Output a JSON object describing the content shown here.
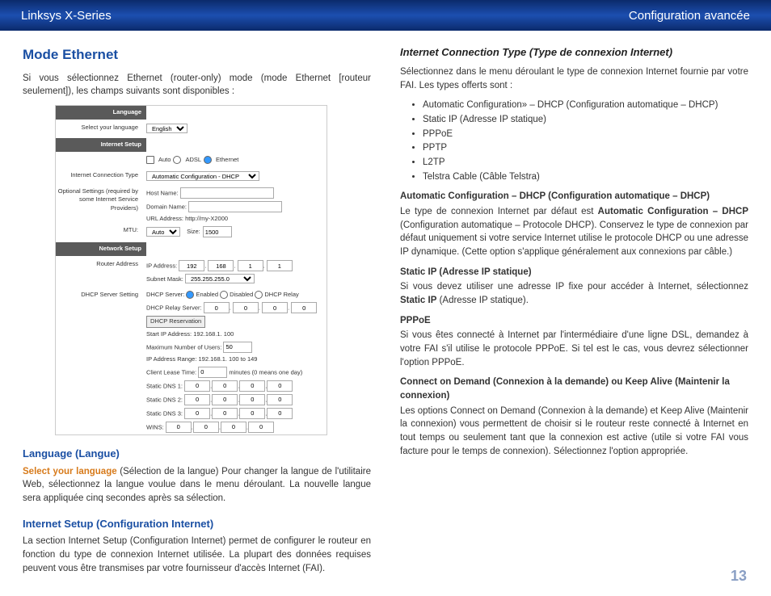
{
  "header": {
    "left": "Linksys X-Series",
    "right": "Configuration avancée"
  },
  "pageNumber": "13",
  "left": {
    "h2": "Mode Ethernet",
    "intro": "Si vous sélectionnez Ethernet (router-only) mode (mode Ethernet [routeur seulement]), les champs suivants sont disponibles :",
    "langH": "Language (Langue)",
    "langLead": "Select your language",
    "langBody": " (Sélection de la langue)  Pour changer la langue de l'utilitaire Web, sélectionnez la langue voulue dans le menu déroulant. La nouvelle langue sera appliquée cinq secondes après sa sélection.",
    "isH": "Internet Setup (Configuration Internet)",
    "isBody": "La section Internet Setup (Configuration Internet) permet de configurer le routeur en fonction du type de connexion Internet utilisée. La plupart des données requises peuvent vous être transmises par votre fournisseur d'accès Internet (FAI).",
    "italicInternetSetup": "Internet Setup"
  },
  "shot": {
    "language": "Language",
    "selectLang": "Select your language",
    "english": "English",
    "internetSetup": "Internet Setup",
    "auto": "Auto",
    "adsl": "ADSL",
    "ethernet": "Ethernet",
    "ict": "Internet Connection Type",
    "ictVal": "Automatic Configuration - DHCP",
    "optional": "Optional Settings (required by some Internet Service Providers)",
    "hostName": "Host Name:",
    "domainName": "Domain Name:",
    "urlAddress": "URL Address:",
    "urlVal": "http://my-X2000",
    "mtu": "MTU:",
    "mtuAuto": "Auto",
    "size": "Size:",
    "sizeVal": "1500",
    "networkSetup": "Network Setup",
    "routerAddress": "Router Address",
    "ipAddress": "IP Address:",
    "subnet": "Subnet Mask:",
    "subnetVal": "255.255.255.0",
    "dhcpSetting": "DHCP Server Setting",
    "dhcpServer": "DHCP Server:",
    "enabled": "Enabled",
    "disabled": "Disabled",
    "relay": "DHCP Relay",
    "relayServer": "DHCP Relay Server:",
    "reservation": "DHCP Reservation",
    "startIP": "Start IP Address:",
    "startIPVal": "192.168.1. 100",
    "maxUsers": "Maximum Number of Users:",
    "maxUsersVal": "50",
    "ipRange": "IP Address Range:",
    "ipRangeVal": "192.168.1. 100 to 149",
    "lease": "Client Lease Time:",
    "leaseVal": "0",
    "leaseUnit": "minutes (0 means one day)",
    "dns1": "Static DNS 1:",
    "dns2": "Static DNS 2:",
    "dns3": "Static DNS 3:",
    "wins": "WINS:",
    "ip": [
      "192",
      "168",
      "1",
      "1"
    ],
    "zero": "0"
  },
  "right": {
    "h4": "Internet Connection Type (Type de connexion Internet)",
    "intro": "Sélectionnez dans le menu déroulant le type de connexion Internet fournie par votre FAI. Les types offerts sont :",
    "types": [
      "Automatic Configuration» – DHCP (Configuration automatique – DHCP)",
      "Static IP (Adresse IP statique)",
      "PPPoE",
      "PPTP",
      "L2TP",
      "Telstra Cable (Câble Telstra)"
    ],
    "autoH": "Automatic Configuration – DHCP (Configuration automatique – DHCP)",
    "autoP1a": "Le type de connexion Internet par défaut est ",
    "autoP1b": "Automatic Configuration – DHCP",
    "autoP1c": " (Configuration automatique – Protocole DHCP). Conservez le type de connexion par défaut uniquement si votre service Internet utilise le protocole DHCP ou une adresse IP dynamique. (Cette option s'applique généralement aux connexions par câble.)",
    "staticH": "Static IP (Adresse IP statique)",
    "staticP1a": "Si vous devez utiliser une adresse IP fixe pour accéder à Internet, sélectionnez ",
    "staticP1b": "Static IP",
    "staticP1c": " (Adresse IP statique).",
    "pppoeH": "PPPoE",
    "pppoeP": "Si vous êtes connecté à Internet par l'intermédiaire d'une ligne DSL, demandez à votre FAI s'il utilise le protocole PPPoE. Si tel est le cas, vous devrez sélectionner l'option PPPoE.",
    "codH": "Connect on Demand (Connexion à la demande) ou Keep Alive (Maintenir la connexion)",
    "codP": "Les options Connect on Demand (Connexion à la demande) et Keep Alive (Maintenir la connexion) vous permettent de choisir si le routeur reste connecté à Internet en tout temps ou seulement tant que la connexion est active (utile si votre FAI vous facture pour le temps de connexion). Sélectionnez l'option appropriée."
  }
}
